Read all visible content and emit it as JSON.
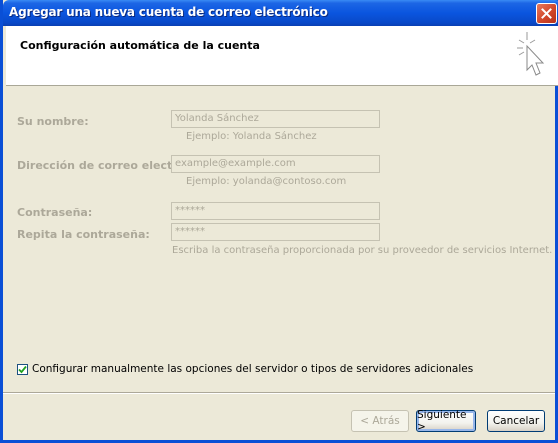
{
  "window": {
    "title": "Agregar una nueva cuenta de correo electrónico"
  },
  "header": {
    "title": "Configuración automática de la cuenta",
    "icon": "wizard-cursor-icon"
  },
  "form": {
    "name_label": "Su nombre:",
    "name_value": "Yolanda Sánchez",
    "name_hint": "Ejemplo: Yolanda Sánchez",
    "email_label": "Dirección de correo electrónico:",
    "email_value": "example@example.com",
    "email_hint": "Ejemplo: yolanda@contoso.com",
    "password_label": "Contraseña:",
    "password_value": "******",
    "repeat_label": "Repita la contraseña:",
    "repeat_value": "******",
    "password_hint": "Escriba la contraseña proporcionada por su proveedor de servicios Internet."
  },
  "manual_config": {
    "checked": true,
    "label": "Configurar manualmente las opciones del servidor o tipos de servidores adicionales"
  },
  "buttons": {
    "back": "< Atrás",
    "next": "Siguiente >",
    "cancel": "Cancelar"
  },
  "colors": {
    "titlebar": "#0a55df",
    "disabled_text": "#aca899",
    "dialog_bg": "#ece9d8"
  }
}
